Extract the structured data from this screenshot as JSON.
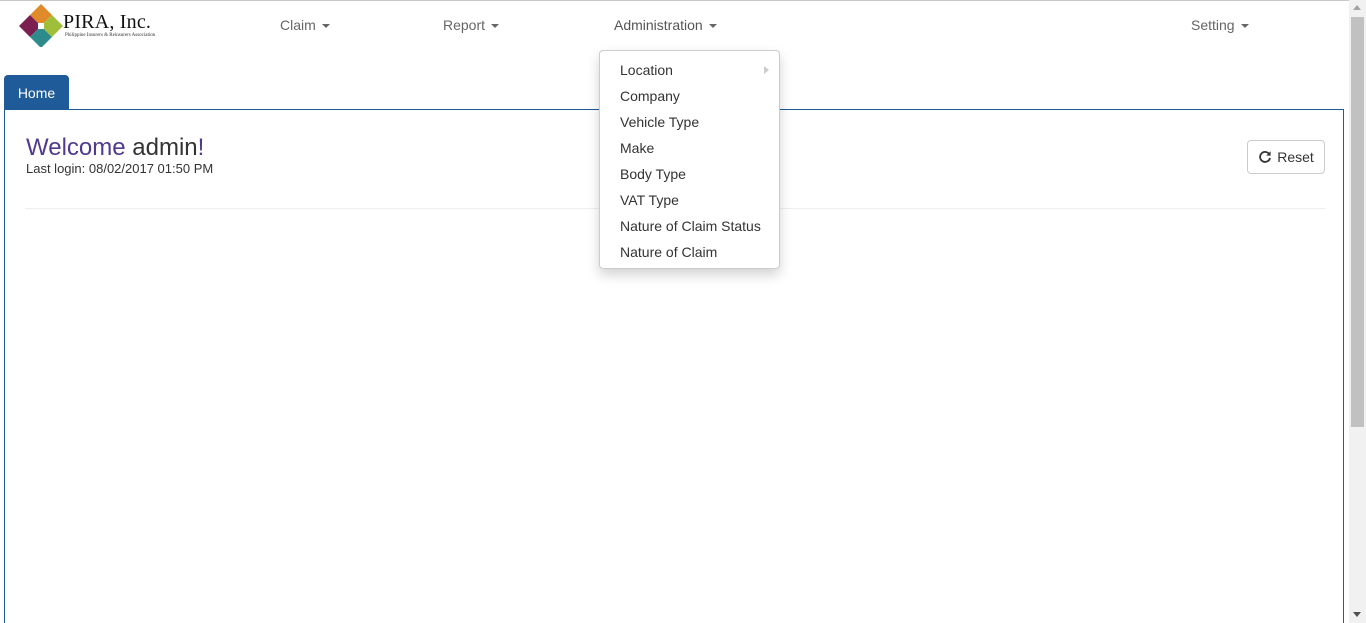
{
  "brand": {
    "title": "PIRA, Inc.",
    "subtitle": "Philippine Insurers & Reinsurers Association",
    "logo_icon": "pira-diamond-logo-icon"
  },
  "nav": {
    "claim": "Claim",
    "report": "Report",
    "administration": "Administration",
    "setting": "Setting"
  },
  "admin_menu": {
    "items": [
      {
        "label": "Location",
        "has_submenu": true
      },
      {
        "label": "Company"
      },
      {
        "label": "Vehicle Type"
      },
      {
        "label": "Make"
      },
      {
        "label": "Body Type"
      },
      {
        "label": "VAT Type"
      },
      {
        "label": "Nature of Claim Status"
      },
      {
        "label": "Nature of Claim"
      }
    ]
  },
  "tabs": {
    "home": "Home"
  },
  "main": {
    "welcome_word": "Welcome",
    "user": "admin",
    "exclaim": "!",
    "last_login": "Last login: 08/02/2017 01:50 PM",
    "reset_label": "Reset",
    "reset_icon": "refresh-icon"
  },
  "colors": {
    "accent": "#1f5a99",
    "welcome_purple": "#4f3a8f"
  }
}
